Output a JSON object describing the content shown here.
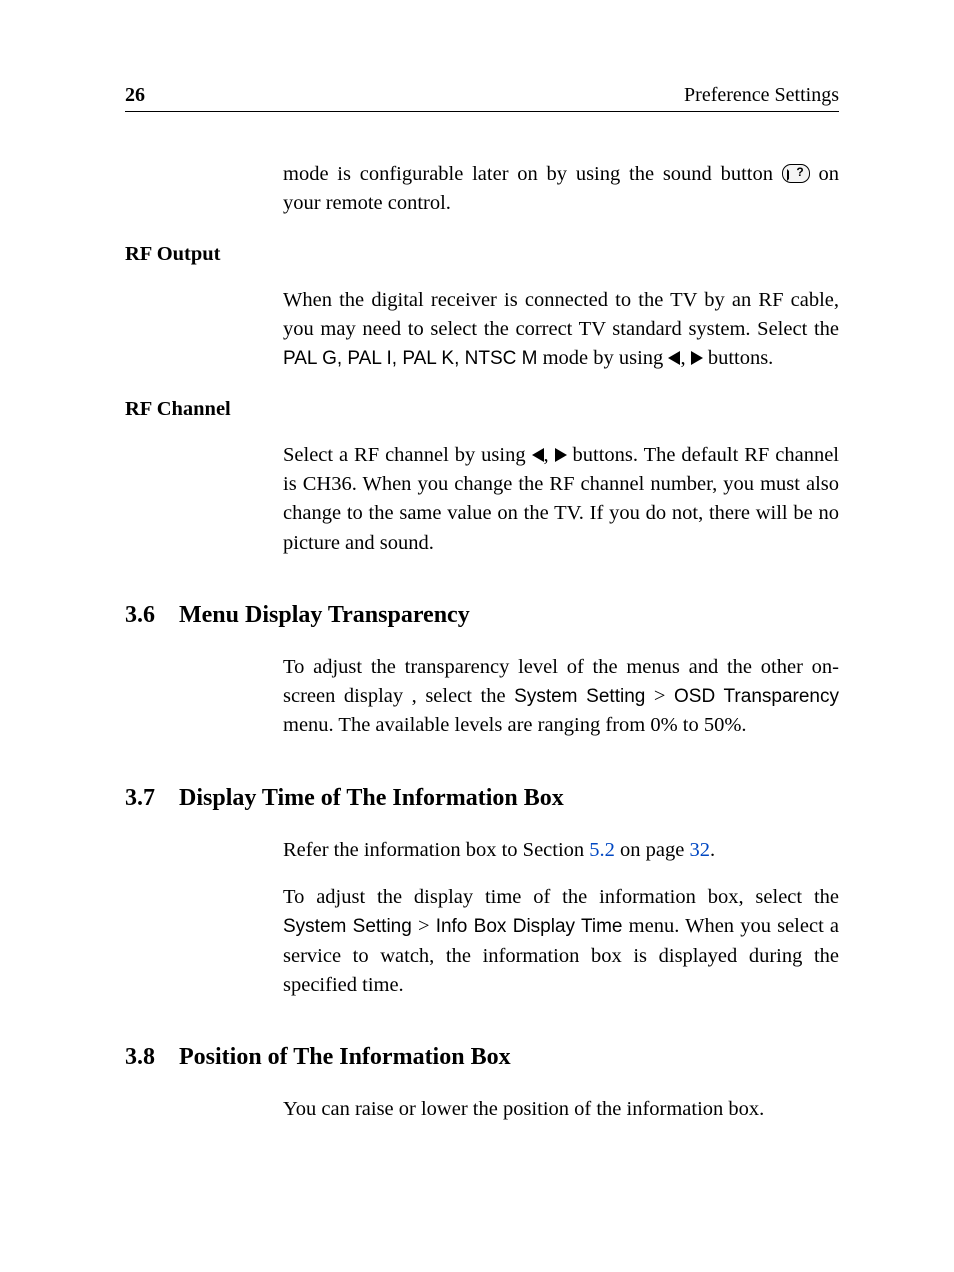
{
  "header": {
    "page_number": "26",
    "running_title": "Preference Settings"
  },
  "intro_paragraph": {
    "before_icon": "mode is configurable later on by using the sound button ",
    "after_icon": " on your remote control."
  },
  "rf_output": {
    "label": "RF Output",
    "p1a": "When the digital receiver is connected to the TV by an RF ca­ble, you may need to select the correct TV standard system. Select the ",
    "modes": "PAL G, PAL I, PAL K, NTSC M",
    "p1b": " mode by using ",
    "p1c": " buttons."
  },
  "rf_channel": {
    "label": "RF Channel",
    "p1a": "Select a RF channel by using ",
    "p1b": " buttons.  The default RF channel is CH36.  When you change the RF channel number, you must also change to the same value on the TV. If you do not, there will be no picture and sound."
  },
  "sec36": {
    "num": "3.6",
    "title": "Menu Display Transparency",
    "p1a": "To adjust the transparency level of the menus and the other on-screen display , select the ",
    "menu1": "System Setting",
    "gt": " > ",
    "menu2": "OSD Trans­parency",
    "p1b": " menu.  The available levels are ranging from 0% to 50%."
  },
  "sec37": {
    "num": "3.7",
    "title": "Display Time of The Information Box",
    "p1a": "Refer the information box to Section ",
    "link_sec": "5.2",
    "p1b": " on page ",
    "link_page": "32",
    "p1c": ".",
    "p2a": "To adjust the display time of the information box, select the ",
    "menu1": "System Setting",
    "gt": " > ",
    "menu2": "Info Box Display Time",
    "p2b": " menu. When you se­lect a service to watch, the information box is displayed dur­ing the specified time."
  },
  "sec38": {
    "num": "3.8",
    "title": "Position of The Information Box",
    "p1": "You can raise or lower the position of the information box."
  }
}
